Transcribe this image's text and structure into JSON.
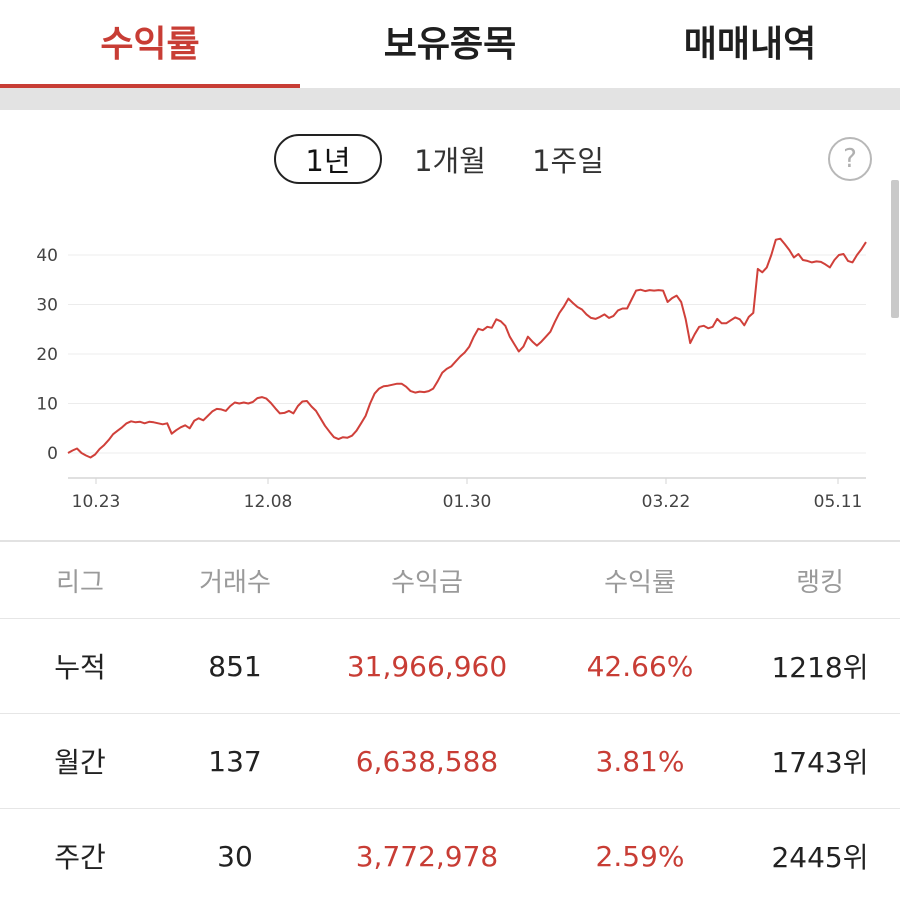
{
  "tabs": [
    {
      "label": "수익률",
      "active": true
    },
    {
      "label": "보유종목",
      "active": false
    },
    {
      "label": "매매내역",
      "active": false
    }
  ],
  "periods": [
    {
      "label": "1년",
      "active": true
    },
    {
      "label": "1개월",
      "active": false
    },
    {
      "label": "1주일",
      "active": false
    }
  ],
  "help_label": "?",
  "colors": {
    "accent": "#c83d35",
    "line": "#d0403a"
  },
  "chart_data": {
    "type": "line",
    "x_ticks": [
      "10.23",
      "12.08",
      "01.30",
      "03.22",
      "05.11"
    ],
    "y_ticks": [
      0,
      10,
      20,
      30,
      40
    ],
    "ylim": [
      -1,
      45
    ],
    "grid": true,
    "series": [
      {
        "values": [
          0,
          0.5,
          0.9,
          0,
          -0.5,
          -0.9,
          -0.3,
          0.8,
          1.6,
          2.6,
          3.8,
          4.5,
          5.2,
          6,
          6.4,
          6.2,
          6.3,
          6,
          6.3,
          6.2,
          6,
          5.8,
          6,
          3.9,
          4.6,
          5.2,
          5.6,
          5,
          6.5,
          7,
          6.6,
          7.5,
          8.4,
          8.9,
          8.8,
          8.5,
          9.5,
          10.2,
          10,
          10.2,
          10,
          10.3,
          11.1,
          11.3,
          11,
          10.1,
          9,
          8,
          8.1,
          8.5,
          8,
          9.5,
          10.4,
          10.5,
          9.4,
          8.5,
          7,
          5.5,
          4.3,
          3.2,
          2.8,
          3.2,
          3.1,
          3.5,
          4.5,
          6,
          7.5,
          10,
          12,
          13,
          13.5,
          13.6,
          13.8,
          14,
          14,
          13.4,
          12.5,
          12.2,
          12.4,
          12.3,
          12.5,
          13,
          14.5,
          16.2,
          17,
          17.5,
          18.5,
          19.5,
          20.3,
          21.5,
          23.5,
          25.1,
          24.8,
          25.5,
          25.3,
          27,
          26.6,
          25.7,
          23.5,
          22,
          20.5,
          21.5,
          23.5,
          22.5,
          21.7,
          22.5,
          23.5,
          24.5,
          26.5,
          28.3,
          29.6,
          31.2,
          30.3,
          29.5,
          29,
          28,
          27.3,
          27.1,
          27.5,
          28,
          27.3,
          27.7,
          28.8,
          29.2,
          29.2,
          31,
          32.8,
          33,
          32.7,
          32.9,
          32.8,
          32.9,
          32.8,
          30.5,
          31.3,
          31.8,
          30.5,
          27,
          22.2,
          24,
          25.5,
          25.7,
          25.2,
          25.5,
          27.1,
          26.2,
          26.2,
          26.8,
          27.4,
          27,
          25.8,
          27.5,
          28.3,
          37.2,
          36.5,
          37.5,
          40,
          43.1,
          43.3,
          42.2,
          41,
          39.5,
          40.2,
          39,
          38.8,
          38.5,
          38.7,
          38.6,
          38.1,
          37.5,
          39,
          40,
          40.2,
          38.8,
          38.5,
          40,
          41.2,
          42.6
        ]
      }
    ]
  },
  "table": {
    "headers": [
      "리그",
      "거래수",
      "수익금",
      "수익률",
      "랭킹"
    ],
    "rows": [
      {
        "league": "누적",
        "trades": "851",
        "profit": "31,966,960",
        "rate": "42.66%",
        "rank": "1218위"
      },
      {
        "league": "월간",
        "trades": "137",
        "profit": "6,638,588",
        "rate": "3.81%",
        "rank": "1743위"
      },
      {
        "league": "주간",
        "trades": "30",
        "profit": "3,772,978",
        "rate": "2.59%",
        "rank": "2445위"
      }
    ]
  }
}
